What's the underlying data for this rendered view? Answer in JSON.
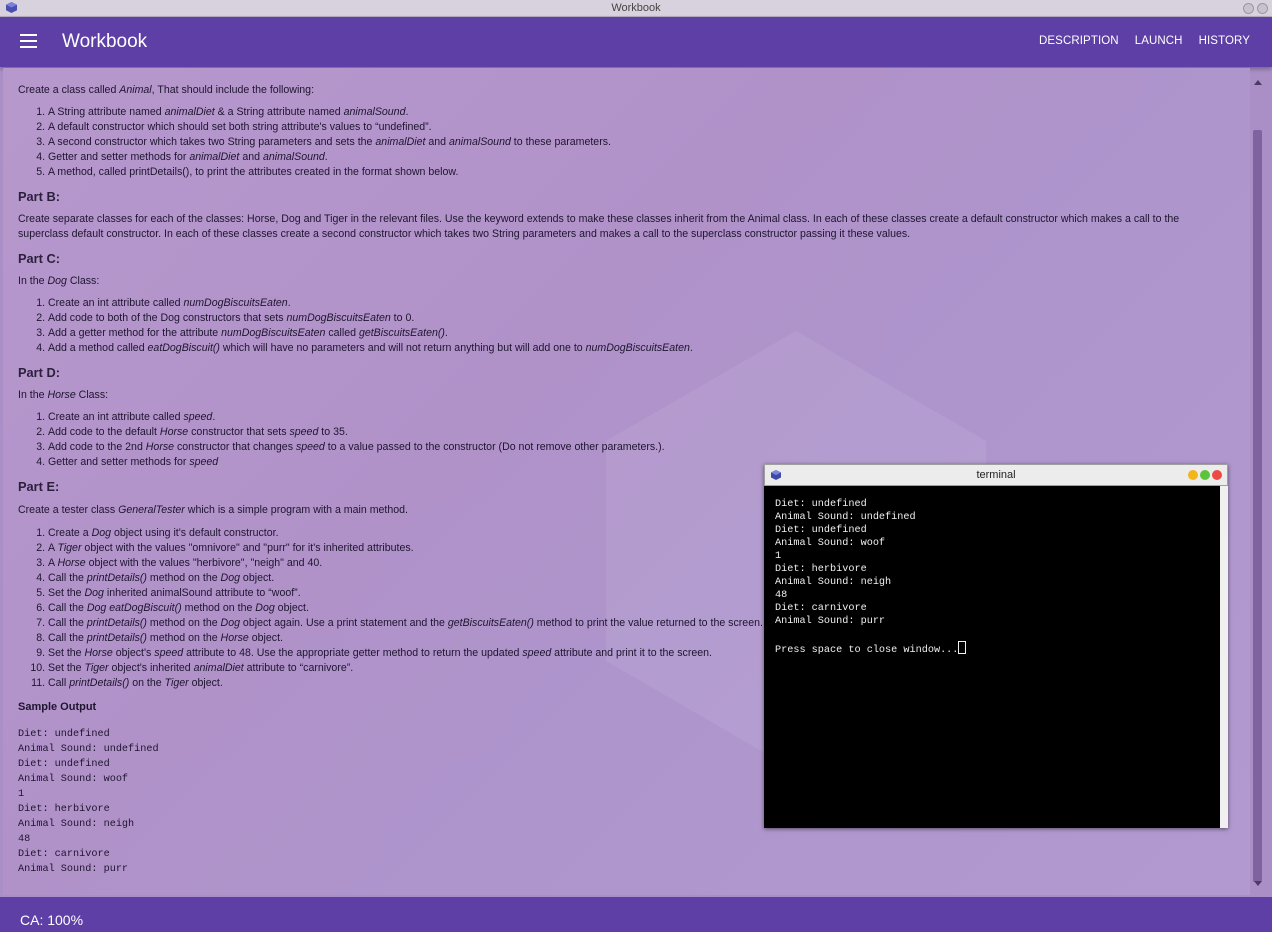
{
  "window": {
    "title": "Workbook"
  },
  "appbar": {
    "title": "Workbook",
    "nav": [
      "DESCRIPTION",
      "LAUNCH",
      "HISTORY"
    ]
  },
  "intro": [
    "Create a class called ",
    "Animal",
    ", That should include the following:"
  ],
  "partA": [
    [
      "A String attribute named ",
      "animalDiet",
      " & a String attribute named ",
      "animalSound",
      "."
    ],
    [
      "A default constructor which should set both string attribute's values to “undefined”."
    ],
    [
      "A second constructor which takes two String parameters and sets the ",
      "animalDiet",
      " and ",
      "animalSound",
      " to these parameters."
    ],
    [
      "Getter and setter methods for ",
      "animalDiet",
      " and ",
      "animalSound",
      "."
    ],
    [
      "A method, called printDetails(), to print the attributes created in the format shown below."
    ]
  ],
  "partB": {
    "heading": "Part B:",
    "text": "Create separate classes for each of the classes: Horse, Dog and Tiger in the relevant files. Use the keyword extends to make these classes inherit from the Animal class. In each of these classes create a default constructor which makes a call to the superclass default constructor. In each of these classes create a second constructor which takes two String parameters and makes a call to the superclass constructor passing it these values."
  },
  "partC": {
    "heading": "Part C:",
    "intro": [
      "In the ",
      "Dog",
      " Class:"
    ],
    "items": [
      [
        "Create an int attribute called ",
        "numDogBiscuitsEaten",
        "."
      ],
      [
        "Add code to both of the Dog constructors that sets ",
        "numDogBiscuitsEaten",
        " to 0."
      ],
      [
        "Add a getter method for the attribute ",
        "numDogBiscuitsEaten",
        " called ",
        "getBiscuitsEaten()",
        "."
      ],
      [
        "Add a method called ",
        "eatDogBiscuit()",
        " which will have no parameters and will not return anything but will add one to ",
        "numDogBiscuitsEaten",
        "."
      ]
    ]
  },
  "partD": {
    "heading": "Part D:",
    "intro": [
      "In the ",
      "Horse",
      " Class:"
    ],
    "items": [
      [
        "Create an int attribute called ",
        "speed",
        "."
      ],
      [
        "Add code to the default ",
        "Horse",
        " constructor that sets ",
        "speed",
        " to 35."
      ],
      [
        "Add code to the 2nd ",
        "Horse",
        " constructor that changes ",
        "speed",
        " to a value passed to the constructor (Do not remove other parameters.)."
      ],
      [
        "Getter and setter methods for ",
        "speed",
        ""
      ]
    ]
  },
  "partE": {
    "heading": "Part E:",
    "intro": [
      "Create a tester class ",
      "GeneralTester",
      " which is a simple program with a main method."
    ],
    "items": [
      [
        "Create a ",
        "Dog",
        " object using it's default constructor."
      ],
      [
        "A ",
        "Tiger",
        " object with the values \"omnivore\" and \"purr\" for it's inherited attributes."
      ],
      [
        "A ",
        "Horse",
        " object with the values \"herbivore\", \"neigh\" and 40."
      ],
      [
        "Call the ",
        "printDetails()",
        " method on the ",
        "Dog",
        " object."
      ],
      [
        "Set the ",
        "Dog",
        " inherited animalSound attribute to “woof”."
      ],
      [
        "Call the ",
        "Dog eatDogBiscuit()",
        " method on the ",
        "Dog",
        " object."
      ],
      [
        "Call the ",
        "printDetails()",
        " method on the ",
        "Dog",
        " object again. Use a print statement and the ",
        "getBiscuitsEaten()",
        " method to print the value returned to the screen."
      ],
      [
        "Call the ",
        "printDetails()",
        " method on the ",
        "Horse",
        " object."
      ],
      [
        "Set the ",
        "Horse",
        " object's ",
        "speed",
        " attribute to 48. Use the appropriate getter method to return the updated ",
        "speed",
        " attribute and print it to the screen."
      ],
      [
        "Set the ",
        "Tiger",
        " object's inherited ",
        "animalDiet",
        " attribute to “carnivore”."
      ],
      [
        "Call ",
        "printDetails()",
        " on the ",
        "Tiger",
        " object."
      ]
    ]
  },
  "sample": {
    "heading": "Sample Output",
    "lines": [
      "Diet: undefined",
      "Animal Sound: undefined",
      "Diet: undefined",
      "Animal Sound: woof",
      "1",
      "Diet: herbivore",
      "Animal Sound: neigh",
      "48",
      "Diet: carnivore",
      "Animal Sound: purr"
    ]
  },
  "terminal": {
    "title": "terminal",
    "lines": [
      "Diet: undefined",
      "Animal Sound: undefined",
      "Diet: undefined",
      "Animal Sound: woof",
      "1",
      "Diet: herbivore",
      "Animal Sound: neigh",
      "48",
      "Diet: carnivore",
      "Animal Sound: purr",
      "",
      "Press space to close window..."
    ],
    "buttons": {
      "minimize": "#f2b51a",
      "maximize": "#5cc43b",
      "close": "#ec4b45"
    }
  },
  "status": {
    "text": "CA: 100%"
  },
  "colors": {
    "appbar": "#5d3fa6",
    "content": "#b296cb"
  },
  "icons": {
    "menu": "hamburger-menu-icon",
    "app": "cube-icon"
  }
}
